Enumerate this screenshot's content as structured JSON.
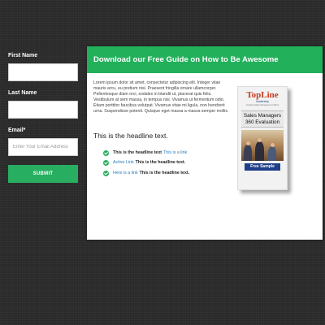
{
  "form": {
    "first_name_label": "First Name",
    "last_name_label": "Last Name",
    "email_label": "Email*",
    "email_placeholder": "Enter Your Email Address",
    "submit_label": "SUBMIT"
  },
  "card": {
    "title": "Download our Free Guide on How to Be Awesome",
    "paragraph": "Lorem ipsum dolor sit amet, consectetur adipiscing elit. Integer vitae mauris arcu, eu pretium nisi. Praesent fringilla ornare ullamcorper. Pellentesque diam orci, sodales in blandit ut, placerat quis felis. Vestibulum at sem massa, in tempus nisi. Vivamus ut fermentum odio. Etiam porttitor faucibus volutpat. Vivamus vitae mi ligula, non hendrerit urna. Suspendisse potenti. Quisque eget massa a massa semper mollis.",
    "headline": "This is the headline text.",
    "items": [
      {
        "text": "This is the headline text",
        "link": "This is a link"
      },
      {
        "link": "Active Link",
        "text": "This is the headline text."
      },
      {
        "link": "Here is a link",
        "text": "This is the headline text."
      }
    ]
  },
  "book": {
    "brand": "TopLine",
    "brand_sub": "leadership",
    "tagline": "Growing Sales Management Talent",
    "title_line1": "Sales Managers",
    "title_line2": "360 Evaluation",
    "sample_label": "Free Sample"
  },
  "colors": {
    "accent_green": "#22b05a",
    "link_blue": "#2a7ab8",
    "background": "#2a2a2a"
  }
}
